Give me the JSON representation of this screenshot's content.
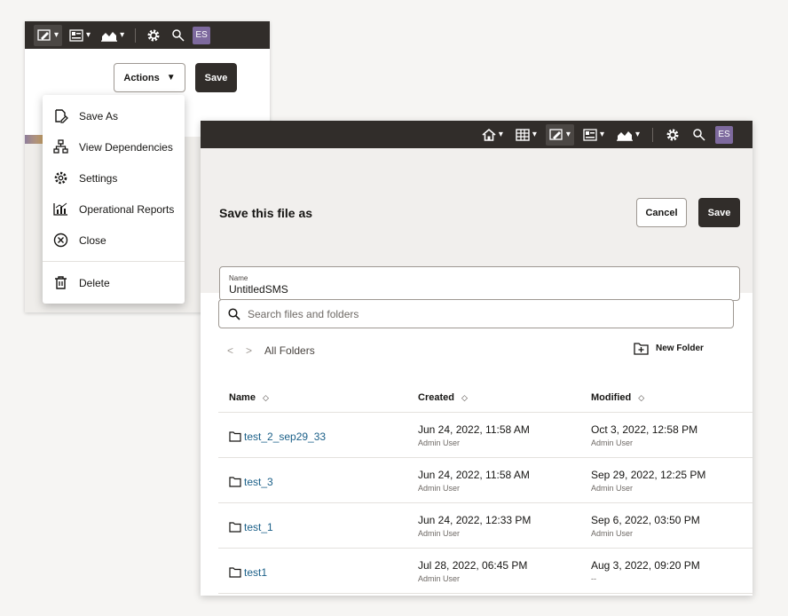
{
  "back_window": {
    "toolbar": {
      "avatar_initials": "ES"
    },
    "actions_label": "Actions",
    "save_label": "Save",
    "menu": [
      {
        "label": "Save As",
        "icon": "save-as-icon"
      },
      {
        "label": "View Dependencies",
        "icon": "dependencies-icon"
      },
      {
        "label": "Settings",
        "icon": "gear-icon"
      },
      {
        "label": "Operational Reports",
        "icon": "report-chart-icon"
      },
      {
        "label": "Close",
        "icon": "close-circle-icon"
      },
      {
        "label": "Delete",
        "icon": "trash-icon"
      }
    ]
  },
  "dialog": {
    "toolbar": {
      "avatar_initials": "ES"
    },
    "title": "Save this file as",
    "cancel_label": "Cancel",
    "save_label": "Save",
    "name_field": {
      "label": "Name",
      "value": "UntitledSMS"
    },
    "search": {
      "placeholder": "Search files and folders"
    },
    "breadcrumb": "All Folders",
    "new_folder_label": "New Folder",
    "columns": {
      "name": "Name",
      "created": "Created",
      "modified": "Modified"
    },
    "rows": [
      {
        "name": "test_2_sep29_33",
        "created": "Jun 24, 2022, 11:58 AM",
        "created_by": "Admin User",
        "modified": "Oct 3, 2022, 12:58 PM",
        "modified_by": "Admin User"
      },
      {
        "name": "test_3",
        "created": "Jun 24, 2022, 11:58 AM",
        "created_by": "Admin User",
        "modified": "Sep 29, 2022, 12:25 PM",
        "modified_by": "Admin User"
      },
      {
        "name": "test_1",
        "created": "Jun 24, 2022, 12:33 PM",
        "created_by": "Admin User",
        "modified": "Sep 6, 2022, 03:50 PM",
        "modified_by": "Admin User"
      },
      {
        "name": "test1",
        "created": "Jul 28, 2022, 06:45 PM",
        "created_by": "Admin User",
        "modified": "Aug 3, 2022, 09:20 PM",
        "modified_by": "--"
      }
    ]
  },
  "colors": {
    "toolbar_bg": "#312d2a",
    "avatar_bg": "#7e6a9e",
    "link": "#1a5f88"
  }
}
